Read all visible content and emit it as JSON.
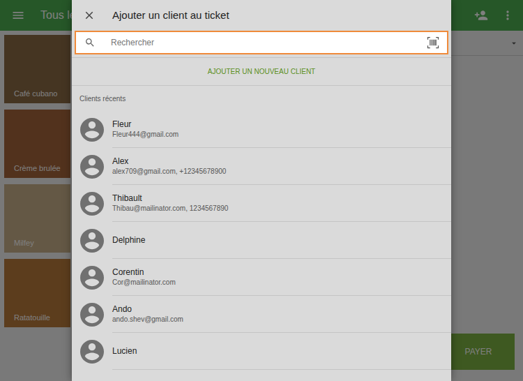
{
  "app": {
    "title": "Tous le",
    "products": [
      {
        "name": "Café cubano"
      },
      {
        "name": "Crème brulée"
      },
      {
        "name": "Milfey"
      },
      {
        "name": "Ratatouille"
      }
    ],
    "pay_button": "PAYER"
  },
  "dialog": {
    "title": "Ajouter un client au ticket",
    "search": {
      "placeholder": "Rechercher"
    },
    "add_button": "AJOUTER UN NOUVEAU CLIENT",
    "section": "Clients récents",
    "clients": [
      {
        "name": "Fleur",
        "details": "Fleur444@gmail.com"
      },
      {
        "name": "Alex",
        "details": "alex709@gmail.com, +12345678900"
      },
      {
        "name": "Thibault",
        "details": "Thibau@mailinator.com, 1234567890"
      },
      {
        "name": "Delphine"
      },
      {
        "name": "Corentin",
        "details": "Cor@mailinator.com"
      },
      {
        "name": "Ando",
        "details": "ando.shev@gmail.com"
      },
      {
        "name": "Lucien"
      }
    ]
  }
}
